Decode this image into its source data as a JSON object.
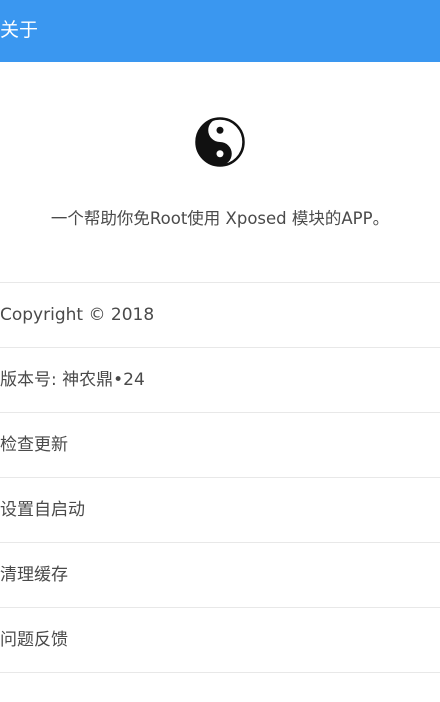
{
  "appbar": {
    "title": "关于",
    "color": "#3a97f0"
  },
  "logo": {
    "icon": "yin-yang-icon"
  },
  "tagline": "一个帮助你免Root使用 Xposed 模块的APP。",
  "menu": {
    "items": [
      {
        "label": "Copyright © 2018",
        "clickable": false
      },
      {
        "label": "版本号: 神农鼎•24",
        "clickable": false
      },
      {
        "label": "检查更新",
        "clickable": true
      },
      {
        "label": "设置自启动",
        "clickable": true
      },
      {
        "label": "清理缓存",
        "clickable": true
      },
      {
        "label": "问题反馈",
        "clickable": true
      }
    ]
  }
}
